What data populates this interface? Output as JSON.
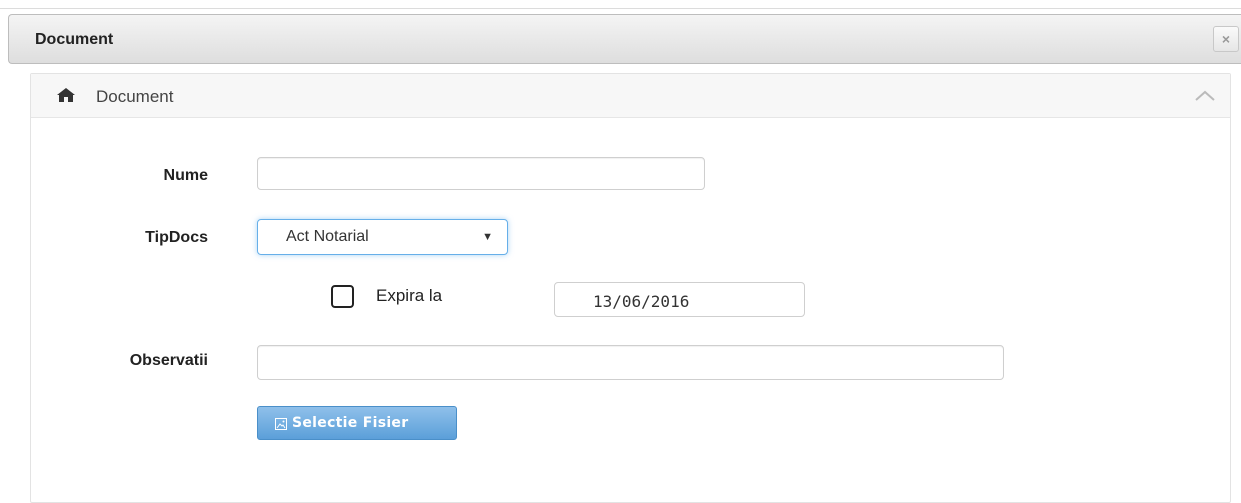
{
  "dialog": {
    "title": "Document",
    "close_label": "×"
  },
  "panel": {
    "title": "Document"
  },
  "form": {
    "nume": {
      "label": "Nume",
      "value": ""
    },
    "tipdocs": {
      "label": "TipDocs",
      "selected": "Act Notarial",
      "caret": "▼"
    },
    "expira": {
      "label": "Expira la",
      "checked": false,
      "date": "13/06/2016"
    },
    "observatii": {
      "label": "Observatii",
      "value": ""
    },
    "file_button": {
      "label": "Selectie Fisier"
    }
  },
  "icons": {
    "header": "home-icon",
    "collapse": "chevron-up-icon",
    "file_button": "picture-icon"
  },
  "colors": {
    "button_bg": "#5b9fd9",
    "focus_border": "#66afe9"
  }
}
